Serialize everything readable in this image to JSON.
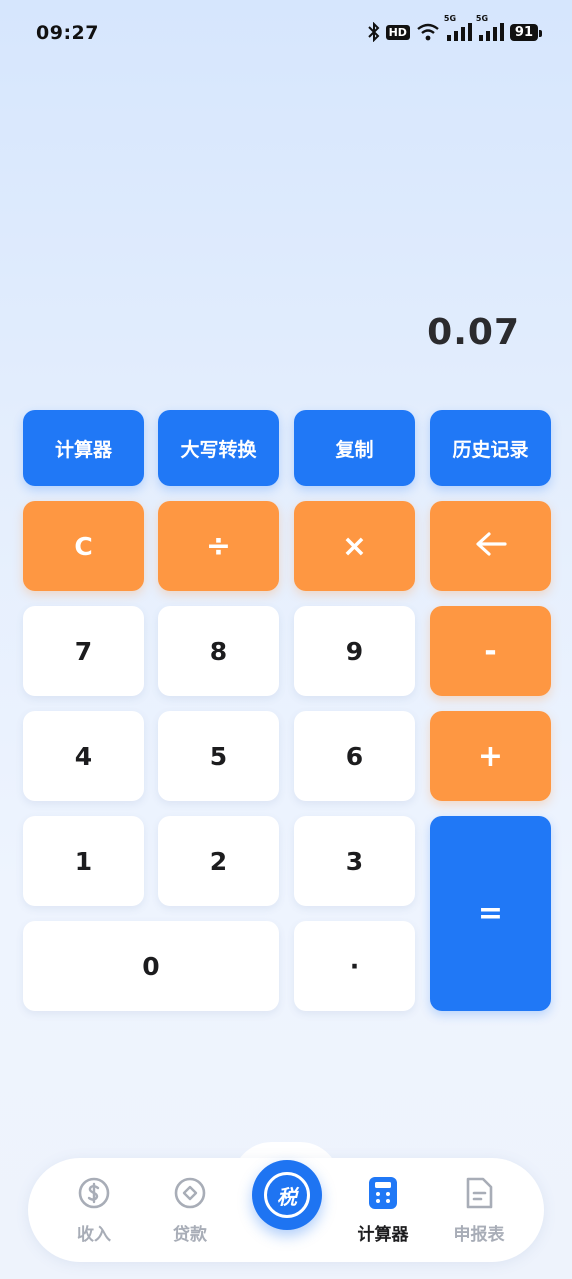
{
  "status_bar": {
    "time": "09:27",
    "network_hd_label": "HD",
    "signal_label": "5G",
    "battery": "91"
  },
  "display": {
    "value": "0.07"
  },
  "function_row": [
    {
      "label": "计算器"
    },
    {
      "label": "大写转换"
    },
    {
      "label": "复制"
    },
    {
      "label": "历史记录"
    }
  ],
  "keys": {
    "clear": "C",
    "divide": "÷",
    "multiply": "×",
    "backspace_icon": "arrow-left-icon",
    "minus": "-",
    "plus": "+",
    "equals": "=",
    "digits": {
      "seven": "7",
      "eight": "8",
      "nine": "9",
      "four": "4",
      "five": "5",
      "six": "6",
      "one": "1",
      "two": "2",
      "three": "3",
      "zero": "0"
    },
    "dot": "·"
  },
  "bottom_nav": {
    "items": [
      {
        "label": "收入",
        "icon": "dollar-circle-icon",
        "active": false
      },
      {
        "label": "贷款",
        "icon": "diamond-circle-icon",
        "active": false
      },
      {
        "label": "计算器",
        "icon": "calculator-icon",
        "active": true
      },
      {
        "label": "申报表",
        "icon": "document-icon",
        "active": false
      }
    ],
    "center_label": "税"
  },
  "colors": {
    "blue": "#2078f6",
    "orange": "#fe9742",
    "white_key": "#ffffff",
    "nav_inactive": "#a8adb7"
  }
}
